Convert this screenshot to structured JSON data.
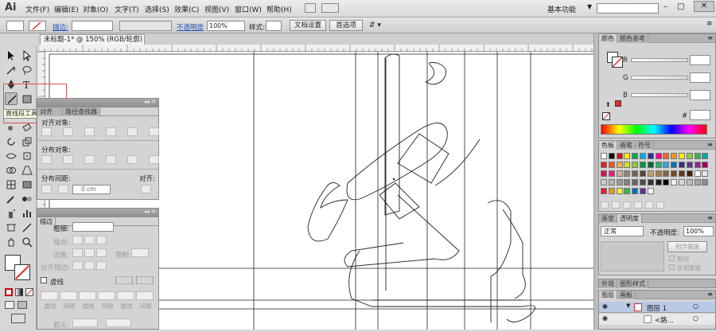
{
  "app": {
    "logo": "Ai"
  },
  "menu": {
    "items": [
      "文件(F)",
      "编辑(E)",
      "对象(O)",
      "文字(T)",
      "选择(S)",
      "效果(C)",
      "视图(V)",
      "窗口(W)",
      "帮助(H)"
    ],
    "workspace": "基本功能"
  },
  "control": {
    "stroke_label": "描边:",
    "opacity_label": "不透明度",
    "opacity_value": "100%",
    "style_label": "样式:",
    "doc_setup": "文档设置",
    "prefs": "首选项"
  },
  "document": {
    "tab_title": "未标题-1* @ 150% (RGB/轮廓)"
  },
  "tooltip": {
    "text": "直线段工具 (\\)"
  },
  "align_panel": {
    "tabs": [
      "对齐",
      "路径查找器"
    ],
    "align_objects": "对齐对象:",
    "distribute_objects": "分布对象:",
    "distribute_spacing": "分布间距:",
    "align_to": "对齐:",
    "spacing_value": "0 cm"
  },
  "stroke_panel": {
    "tab": "描边",
    "weight_label": "粗细:",
    "cap_label": "端点:",
    "corner_label": "边角:",
    "limit_label": "限制:",
    "align_label": "对齐描边:",
    "dashed_label": "虚线",
    "dash_labels": [
      "虚线",
      "间隙",
      "虚线",
      "间隙",
      "虚线",
      "间隙"
    ],
    "arrow_label": "箭头:"
  },
  "color_panel": {
    "tabs": [
      "颜色",
      "颜色参考"
    ],
    "channels": [
      "R",
      "G",
      "B"
    ],
    "hash": "#"
  },
  "swatches_panel": {
    "tabs": [
      "色板",
      "画笔",
      "符号"
    ]
  },
  "transparency_panel": {
    "tabs": [
      "渐变",
      "透明度"
    ],
    "mode": "正常",
    "opacity_label": "不透明度:",
    "opacity_value": "100%",
    "make_mask": "制作蒙版",
    "clip": "剪切",
    "invert_mask": "反相蒙版"
  },
  "appearance_tabs": [
    "外观",
    "图形样式"
  ],
  "layers_panel": {
    "tabs": [
      "图层",
      "画板"
    ],
    "layer_name": "图层 1",
    "sublayer_name": "<路..."
  },
  "colors": {
    "accent_red": "#e0302a",
    "highlight_box": "#e05050"
  },
  "swatch_colors": [
    [
      "#ffffff",
      "#000000",
      "#e30613",
      "#ffed00",
      "#00a651",
      "#00aeef",
      "#2e3192",
      "#ec008c",
      "#f26522",
      "#f7941d",
      "#fff200",
      "#8dc63f",
      "#39b54a",
      "#00a99d"
    ],
    [
      "#ed1c24",
      "#f15a24",
      "#fbb040",
      "#d9e021",
      "#8cc63f",
      "#009245",
      "#006837",
      "#22b573",
      "#29abe2",
      "#0071bc",
      "#2e3192",
      "#662d91",
      "#93278f",
      "#9e005d"
    ],
    [
      "#d4145a",
      "#ed1e79",
      "#c7b299",
      "#998675",
      "#736357",
      "#534741",
      "#c69c6d",
      "#a67c52",
      "#8c6239",
      "#754c24",
      "#603813",
      "#42210b",
      "#ffffff",
      "#e6e6e6"
    ],
    [
      "#cccccc",
      "#b3b3b3",
      "#999999",
      "#808080",
      "#666666",
      "#4d4d4d",
      "#333333",
      "#1a1a1a",
      "#000000",
      "#f2f2f2",
      "#d9d9d9",
      "#bfbfbf",
      "#a6a6a6",
      "#8c8c8c"
    ],
    [
      "#ed1c24",
      "#f7931e",
      "#fcee21",
      "#39b54a",
      "#0071bc",
      "#662d91",
      "#ffffff"
    ]
  ]
}
